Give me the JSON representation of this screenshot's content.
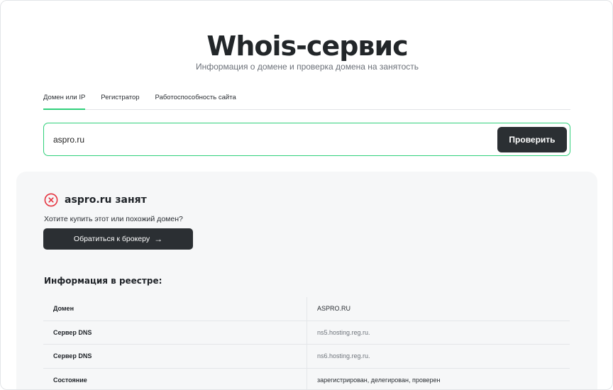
{
  "header": {
    "title": "Whois-сервис",
    "subtitle": "Информация о домене и проверка домена на занятость"
  },
  "tabs": [
    {
      "label": "Домен или IP",
      "active": true
    },
    {
      "label": "Регистратор",
      "active": false
    },
    {
      "label": "Работоспособность сайта",
      "active": false
    }
  ],
  "search": {
    "value": "aspro.ru",
    "button_label": "Проверить"
  },
  "result": {
    "status_icon": "close-circle-icon",
    "status_title": "aspro.ru занят",
    "buy_question": "Хотите купить этот или похожий домен?",
    "broker_button_label": "Обратиться к брокеру",
    "broker_button_icon": "arrow-right-icon",
    "registry_heading": "Информация в реестре:",
    "registry_rows": [
      {
        "key": "Домен",
        "value": "ASPRO.RU",
        "muted": false
      },
      {
        "key": "Сервер DNS",
        "value": "ns5.hosting.reg.ru.",
        "muted": true
      },
      {
        "key": "Сервер DNS",
        "value": "ns6.hosting.reg.ru.",
        "muted": true
      },
      {
        "key": "Состояние",
        "value": "зарегистрирован, делегирован, проверен",
        "muted": false
      }
    ]
  },
  "colors": {
    "accent": "#2fd07a",
    "button_dark": "#2b2f33",
    "error": "#e5323e",
    "panel_bg": "#f6f7f8"
  }
}
